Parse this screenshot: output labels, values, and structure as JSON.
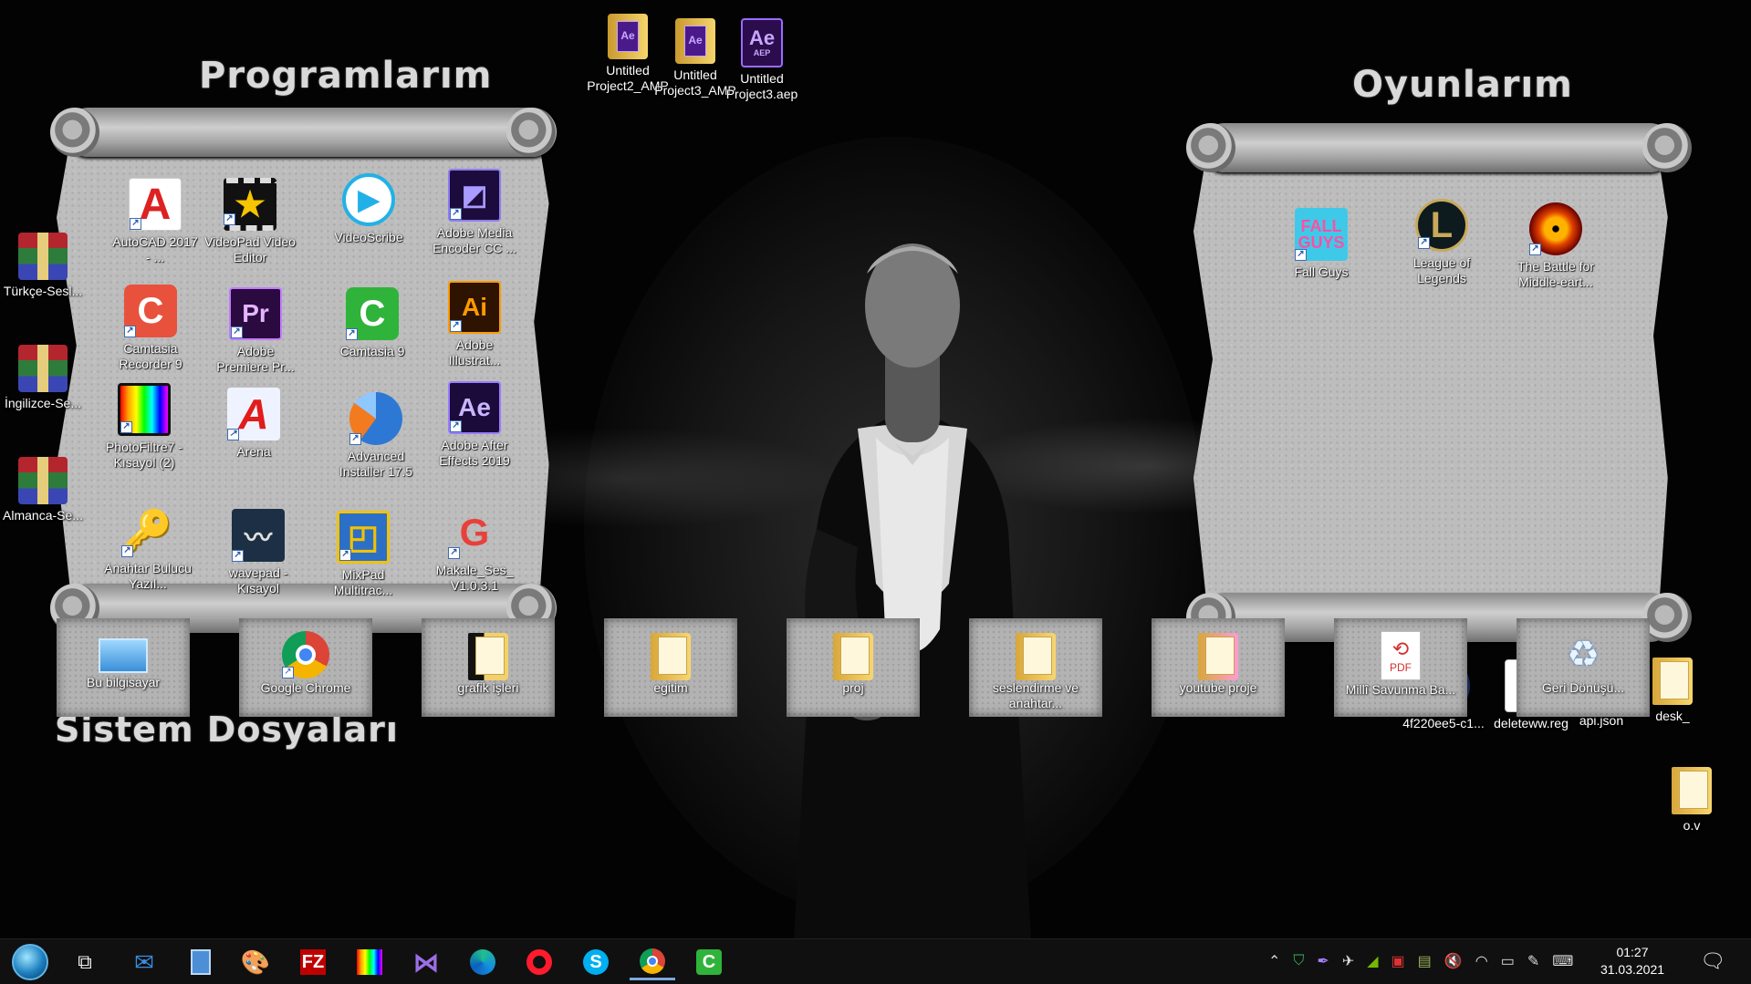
{
  "sections": {
    "programs_title": "Programlarım",
    "games_title": "Oyunlarım",
    "system_title": "Sistem Dosyaları"
  },
  "top_files": [
    {
      "label": "Untitled Project2_AMP",
      "icon": "ae-project-folder-icon"
    },
    {
      "label": "Untitled Project3_AMP",
      "icon": "ae-project-folder-icon"
    },
    {
      "label": "Untitled Project3.aep",
      "icon": "ae-aep-file-icon"
    }
  ],
  "left_archives": [
    {
      "label": "Türkçe-Sesl...",
      "icon": "winrar-archive-icon"
    },
    {
      "label": "İngilizce-Se...",
      "icon": "winrar-archive-icon"
    },
    {
      "label": "Almanca-Se...",
      "icon": "winrar-archive-icon"
    }
  ],
  "programs": [
    {
      "label": "AutoCAD 2017 - ...",
      "icon": "autocad-icon"
    },
    {
      "label": "VideoPad Video Editor",
      "icon": "videopad-icon"
    },
    {
      "label": "VideoScribe",
      "icon": "videoscribe-icon"
    },
    {
      "label": "Adobe Media Encoder CC ...",
      "icon": "media-encoder-icon"
    },
    {
      "label": "Camtasia Recorder 9",
      "icon": "camtasia-recorder-icon"
    },
    {
      "label": "Adobe Premiere Pr...",
      "icon": "premiere-icon"
    },
    {
      "label": "Camtasia 9",
      "icon": "camtasia-icon"
    },
    {
      "label": "Adobe Illustrat...",
      "icon": "illustrator-icon"
    },
    {
      "label": "PhotoFiltre7 - Kısayol (2)",
      "icon": "photofiltre-icon"
    },
    {
      "label": "Arena",
      "icon": "arena-icon"
    },
    {
      "label": "Advanced Installer 17.5",
      "icon": "advanced-installer-icon"
    },
    {
      "label": "Adobe After Effects 2019",
      "icon": "after-effects-icon"
    },
    {
      "label": "Anahtar Bulucu Yazıl...",
      "icon": "key-finder-icon"
    },
    {
      "label": "wavepad - Kısayol",
      "icon": "wavepad-icon"
    },
    {
      "label": "MixPad Multitrac...",
      "icon": "mixpad-icon"
    },
    {
      "label": "Makale_Ses_ V1.0.3.1",
      "icon": "makale-ses-icon"
    }
  ],
  "games": [
    {
      "label": "Fall Guys",
      "icon": "fall-guys-icon"
    },
    {
      "label": "League of Legends",
      "icon": "league-of-legends-icon"
    },
    {
      "label": "The Battle for Middle-eart...",
      "icon": "middle-earth-icon"
    }
  ],
  "right_files": [
    {
      "label": "4f220ee5-c1...",
      "icon": "media-file-icon"
    },
    {
      "label": "deleteww.reg",
      "icon": "registry-file-icon"
    },
    {
      "label": "api.json",
      "icon": "notepad-file-icon"
    },
    {
      "label": "desk_",
      "icon": "folder-icon"
    }
  ],
  "system_files": [
    {
      "label": "Bu bilgisayar",
      "icon": "this-pc-icon"
    },
    {
      "label": "Google Chrome",
      "icon": "chrome-icon"
    },
    {
      "label": "grafik işleri",
      "icon": "folder-icon"
    },
    {
      "label": "egitim",
      "icon": "folder-icon"
    },
    {
      "label": "proj",
      "icon": "folder-icon"
    },
    {
      "label": "seslendirme ve anahtar...",
      "icon": "folder-icon"
    },
    {
      "label": "youtube proje",
      "icon": "folder-icon"
    },
    {
      "label": "Millî Savunma Ba...",
      "icon": "pdf-file-icon"
    },
    {
      "label": "Geri Dönüşü...",
      "icon": "recycle-bin-icon"
    }
  ],
  "extra_folder": {
    "label": "o.v",
    "icon": "folder-icon"
  },
  "taskbar": {
    "apps": [
      "start-orb-icon",
      "task-view-icon",
      "mail-icon",
      "calculator-icon",
      "paint-icon",
      "filezilla-icon",
      "photofiltre-icon",
      "visual-studio-icon",
      "edge-icon",
      "opera-icon",
      "skype-icon",
      "chrome-icon",
      "camtasia-icon"
    ],
    "time": "01:27",
    "date": "31.03.2021"
  }
}
